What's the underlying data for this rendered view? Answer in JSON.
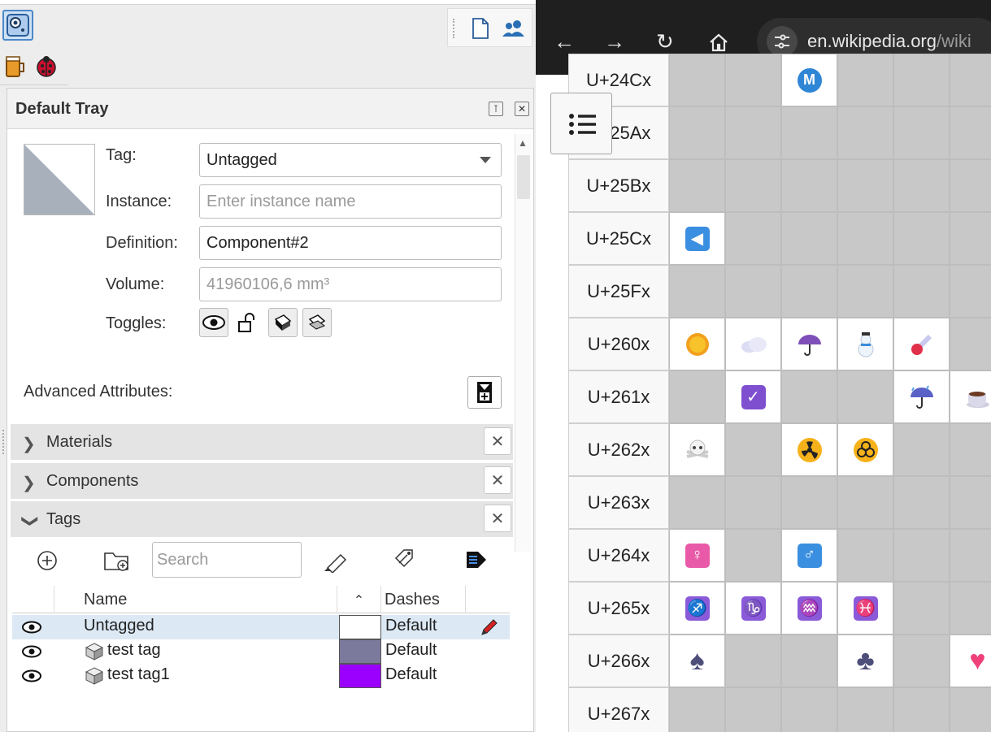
{
  "tray": {
    "title": "Default Tray",
    "entity_info": {
      "tag_label": "Tag:",
      "tag_value": "Untagged",
      "instance_label": "Instance:",
      "instance_placeholder": "Enter instance name",
      "definition_label": "Definition:",
      "definition_value": "Component#2",
      "volume_label": "Volume:",
      "volume_value": "41960106,6 mm³",
      "toggles_label": "Toggles:",
      "advanced_label": "Advanced Attributes:"
    },
    "sections": {
      "materials": "Materials",
      "components": "Components",
      "tags": "Tags"
    },
    "tags_panel": {
      "search_placeholder": "Search",
      "columns": {
        "name": "Name",
        "dashes": "Dashes"
      },
      "rows": [
        {
          "name": "Untagged",
          "color": "#ffffff",
          "dashes": "Default"
        },
        {
          "name": "test tag",
          "color": "#7b7a9c",
          "dashes": "Default"
        },
        {
          "name": "test tag1",
          "color": "#9b00ff",
          "dashes": "Default"
        }
      ]
    }
  },
  "browser": {
    "url_host": "en.wikipedia.org",
    "url_rest": "/wiki",
    "rows": [
      "U+24Cx",
      "U+25Ax",
      "U+25Bx",
      "U+25Cx",
      "U+25Fx",
      "U+260x",
      "U+261x",
      "U+262x",
      "U+263x",
      "U+264x",
      "U+265x",
      "U+266x",
      "U+267x"
    ]
  }
}
